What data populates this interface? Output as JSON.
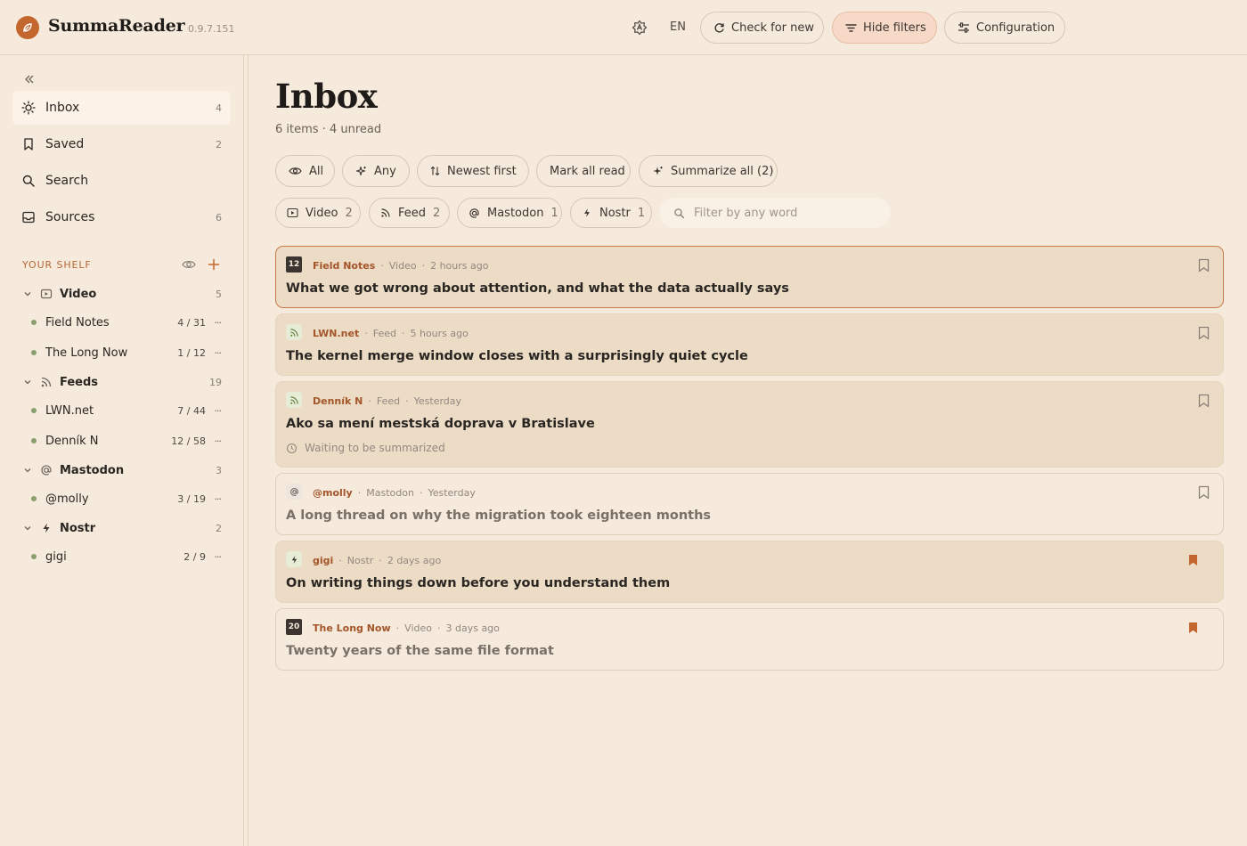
{
  "app": {
    "name": "SummaReader",
    "version": "0.9.7.151"
  },
  "header": {
    "theme_icon": "contrast-icon",
    "language": "EN",
    "check_label": "Check for new",
    "filters_label": "Hide filters",
    "config_label": "Configuration",
    "accent": "#c4672f"
  },
  "sidebar": {
    "nav": [
      {
        "label": "Inbox",
        "count": "4",
        "icon": "sun-icon"
      },
      {
        "label": "Saved",
        "count": "2",
        "icon": "bookmark-icon"
      },
      {
        "label": "Search",
        "count": "",
        "icon": "search-icon"
      },
      {
        "label": "Sources",
        "count": "6",
        "icon": "inbox-tray-icon"
      }
    ],
    "shelf_title": "YOUR SHELF",
    "groups": [
      {
        "label": "Video",
        "count": "5",
        "sources": [
          {
            "label": "Field Notes",
            "count": "4 / 31"
          },
          {
            "label": "The Long Now",
            "count": "1 / 12"
          }
        ]
      },
      {
        "label": "Feeds",
        "count": "19",
        "sources": [
          {
            "label": "LWN.net",
            "count": "7 / 44"
          },
          {
            "label": "Denník N",
            "count": "12 / 58"
          }
        ]
      },
      {
        "label": "Mastodon",
        "count": "3",
        "sources": [
          {
            "label": "@molly",
            "count": "3 / 19"
          }
        ]
      },
      {
        "label": "Nostr",
        "count": "2",
        "sources": [
          {
            "label": "gigi",
            "count": "2 / 9"
          }
        ]
      }
    ],
    "more_glyph": "···"
  },
  "main": {
    "title": "Inbox",
    "subtitle": "6 items · 4 unread",
    "chips": {
      "all": "All",
      "any": "Any",
      "sort": "Newest first",
      "mark_read": "Mark all read",
      "summarize": "Summarize all (2)"
    },
    "type_chips": [
      {
        "label": "Video",
        "count": "2"
      },
      {
        "label": "Feed",
        "count": "2"
      },
      {
        "label": "Mastodon",
        "count": "1"
      },
      {
        "label": "Nostr",
        "count": "1"
      }
    ],
    "filter_placeholder": "Filter by any word",
    "items": [
      {
        "avatar": "12",
        "source": "Field Notes",
        "type": "Video",
        "time": "2 hours ago",
        "title": "What we got wrong about attention, and what the data actually says",
        "read": false,
        "saved": false
      },
      {
        "avatar": "rss-icon",
        "source": "LWN.net",
        "type": "Feed",
        "time": "5 hours ago",
        "title": "The kernel merge window closes with a surprisingly quiet cycle",
        "read": false,
        "saved": false
      },
      {
        "avatar": "rss-icon",
        "source": "Denník N",
        "type": "Feed",
        "time": "Yesterday",
        "title": "Ako sa mení mestská doprava v Bratislave",
        "read": false,
        "saved": false,
        "status": "Waiting to be summarized"
      },
      {
        "avatar": "at-icon",
        "source": "@molly",
        "type": "Mastodon",
        "time": "Yesterday",
        "title": "A long thread on why the migration took eighteen months",
        "read": true,
        "saved": false
      },
      {
        "avatar": "bolt-icon",
        "source": "gigi",
        "type": "Nostr",
        "time": "2 days ago",
        "title": "On writing things down before you understand them",
        "read": false,
        "saved": true
      },
      {
        "avatar": "20",
        "source": "The Long Now",
        "type": "Video",
        "time": "3 days ago",
        "title": "Twenty years of the same file format",
        "read": true,
        "saved": true
      }
    ],
    "separator": "·"
  }
}
